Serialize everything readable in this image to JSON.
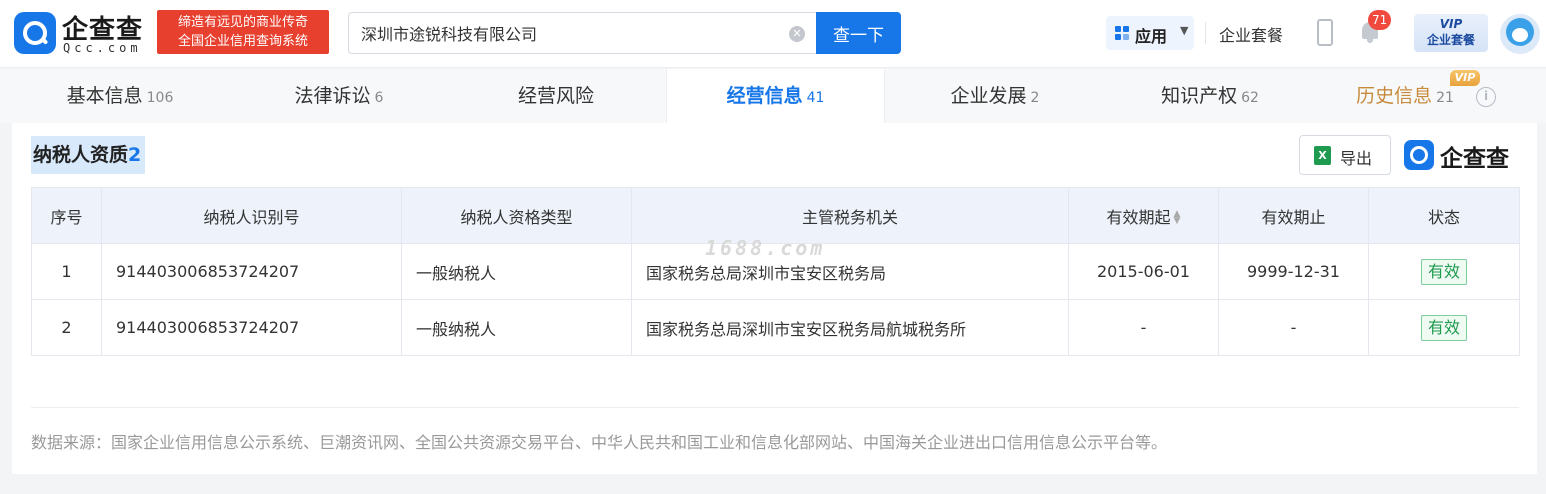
{
  "header": {
    "logo_text": "企查查",
    "logo_sub": "Qcc.com",
    "slogan_line1": "缔造有远见的商业传奇",
    "slogan_line2": "全国企业信用查询系统",
    "search_value": "深圳市途锐科技有限公司",
    "search_button": "查一下",
    "apps_label": "应用",
    "suite_label": "企业套餐",
    "notification_count": "71",
    "vip_top": "VIP",
    "vip_bottom": "企业套餐"
  },
  "tabs": [
    {
      "label": "基本信息",
      "count": "106"
    },
    {
      "label": "法律诉讼",
      "count": "6"
    },
    {
      "label": "经营风险",
      "count": ""
    },
    {
      "label": "经营信息",
      "count": "41"
    },
    {
      "label": "企业发展",
      "count": "2"
    },
    {
      "label": "知识产权",
      "count": "62"
    },
    {
      "label": "历史信息",
      "count": "21"
    }
  ],
  "history_vip_tag": "VIP",
  "section": {
    "title": "纳税人资质",
    "count": "2",
    "export_label": "导出",
    "brand_text": "企查查"
  },
  "table": {
    "headers": [
      "序号",
      "纳税人识别号",
      "纳税人资格类型",
      "主管税务机关",
      "有效期起",
      "有效期止",
      "状态"
    ],
    "rows": [
      [
        "1",
        "914403006853724207",
        "一般纳税人",
        "国家税务总局深圳市宝安区税务局",
        "2015-06-01",
        "9999-12-31",
        "有效"
      ],
      [
        "2",
        "914403006853724207",
        "一般纳税人",
        "国家税务总局深圳市宝安区税务局航城税务所",
        "-",
        "-",
        "有效"
      ]
    ]
  },
  "watermark": "1688.com",
  "data_source": "数据来源：国家企业信用信息公示系统、巨潮资讯网、全国公共资源交易平台、中华人民共和国工业和信息化部网站、中国海关企业进出口信用信息公示平台等。",
  "colors": {
    "primary": "#1776e8",
    "slogan_red": "#e8402f",
    "status_green": "#1e9b4e",
    "history_gold": "#c78a3c"
  }
}
